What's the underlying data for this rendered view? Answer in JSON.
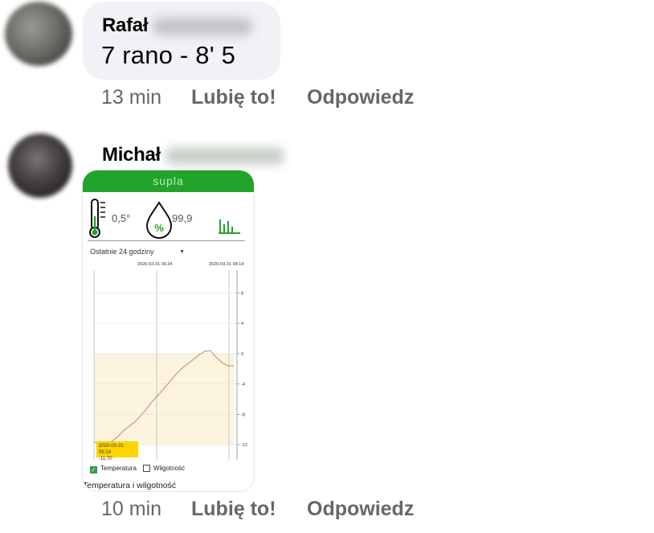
{
  "comments": [
    {
      "author": "Rafał",
      "text": "7 rano - 8' 5",
      "time": "13 min",
      "like_label": "Lubię to!",
      "reply_label": "Odpowiedz"
    },
    {
      "author": "Michał",
      "time": "10 min",
      "like_label": "Lubię to!",
      "reply_label": "Odpowiedz",
      "attachment": {
        "app_title": "supla",
        "temperature_value": "0,5°",
        "humidity_value": "99,9",
        "humidity_symbol": "%",
        "range_label": "Ostatnie 24 godziny",
        "date_labels": [
          "2020-03-31 06:34",
          "2020-03-31 08:14"
        ],
        "tooltip": {
          "date": "2020-03-31 05:14",
          "value": "-11,70"
        },
        "legend": [
          "Temperatura",
          "Wilgotność"
        ],
        "bottom_title": "Temperatura i wilgotność",
        "colors": {
          "brand": "#22a32b",
          "line": "#d9a08c",
          "highlight": "#ffd400"
        }
      }
    }
  ],
  "chart_data": {
    "type": "line",
    "title": "",
    "xlabel": "",
    "ylabel": "",
    "y_ticks": [
      8,
      4,
      0,
      -4,
      -8,
      -12
    ],
    "ylim": [
      -14,
      11
    ],
    "series": [
      {
        "name": "Temperatura",
        "x": [
          0,
          1,
          2,
          3,
          4,
          5,
          6,
          7,
          8,
          9,
          10,
          11,
          12,
          13,
          14,
          15,
          16,
          17,
          18,
          19,
          20,
          21,
          22,
          23,
          24
        ],
        "values": [
          -11.7,
          -11.6,
          -11.7,
          -11.6,
          -11.0,
          -10.2,
          -9.6,
          -9.0,
          -8.2,
          -7.3,
          -6.3,
          -5.5,
          -4.6,
          -3.7,
          -2.8,
          -2.0,
          -1.4,
          -0.8,
          -0.2,
          0.3,
          0.4,
          -0.5,
          -1.2,
          -1.6,
          -1.6
        ]
      }
    ],
    "grid": true
  }
}
